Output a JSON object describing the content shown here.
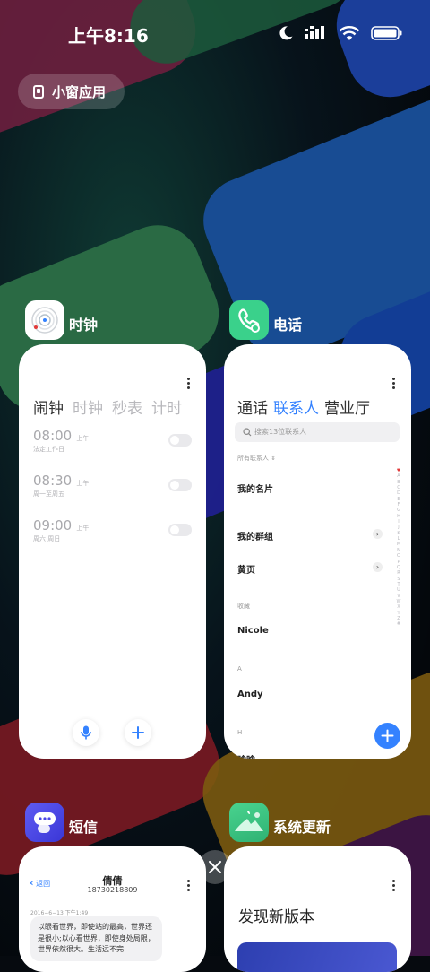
{
  "status_bar": {
    "time": "上午8:16"
  },
  "recent_header": {
    "small_window_label": "小窗应用"
  },
  "apps": {
    "clock": {
      "name": "时钟",
      "tabs": [
        "闹钟",
        "时钟",
        "秒表",
        "计时"
      ],
      "alarms": [
        {
          "time": "08:00",
          "ampm": "上午",
          "repeat": "法定工作日"
        },
        {
          "time": "08:30",
          "ampm": "上午",
          "repeat": "周一至周五"
        },
        {
          "time": "09:00",
          "ampm": "上午",
          "repeat": "周六 周日"
        }
      ]
    },
    "phone": {
      "name": "电话",
      "tabs": [
        "通话",
        "联系人",
        "营业厅"
      ],
      "search_placeholder": "搜索13位联系人",
      "all_contacts": "所有联系人",
      "my_card": "我的名片",
      "my_groups": "我的群组",
      "yellow_pages": "黄页",
      "favorites_header": "收藏",
      "favorite_1": "Nicole",
      "section_a": "A",
      "contact_a": "Andy",
      "section_h": "H",
      "contact_h": "晗晗",
      "alphabet": [
        "♥",
        "A",
        "B",
        "C",
        "D",
        "E",
        "F",
        "G",
        "H",
        "I",
        "J",
        "K",
        "L",
        "M",
        "N",
        "O",
        "P",
        "Q",
        "R",
        "S",
        "T",
        "U",
        "V",
        "W",
        "X",
        "Y",
        "Z",
        "#"
      ]
    },
    "messages": {
      "name": "短信",
      "back_label": "返回",
      "contact_name": "倩倩",
      "contact_number": "18730218809",
      "timestamp": "2016−6−13 下午1:49",
      "bubble_text": "以眼看世界，即使站的最高，世界还是很小;以心看世界，即使身处局限，世界依然很大。生活远不完"
    },
    "updater": {
      "name": "系统更新",
      "headline": "发现新版本"
    }
  },
  "colors": {
    "accent": "#3482ff"
  }
}
